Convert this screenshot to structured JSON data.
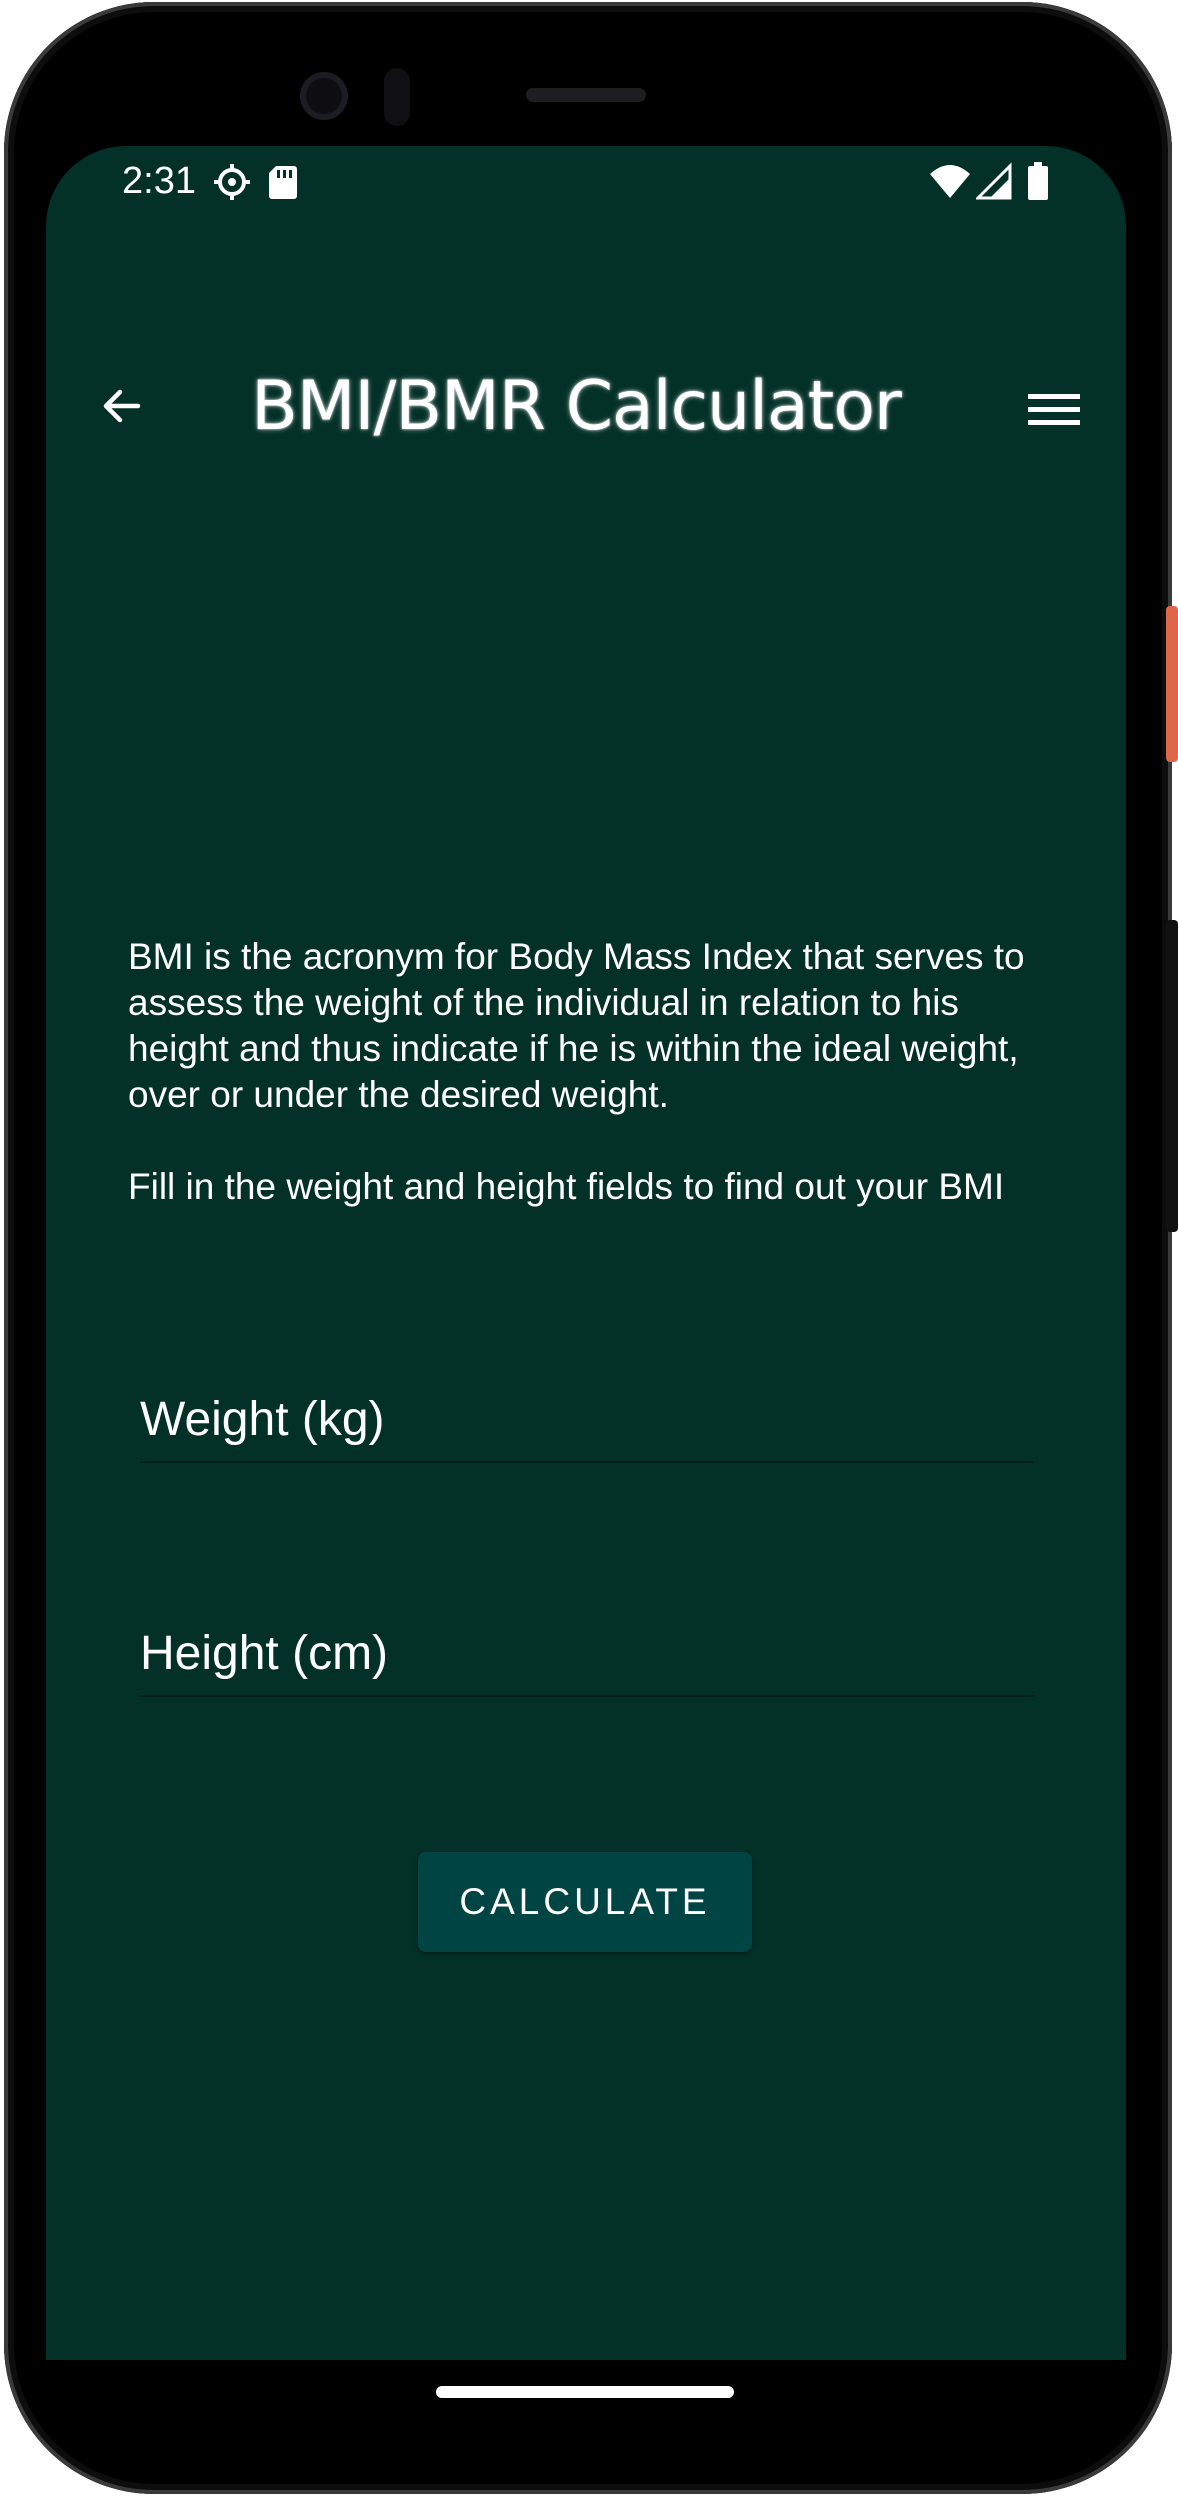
{
  "status_bar": {
    "time": "2:31",
    "icons_left": [
      "settings-gear-icon",
      "sd-card-icon"
    ],
    "icons_right": [
      "wifi-icon",
      "cell-signal-icon",
      "battery-icon"
    ]
  },
  "app_bar": {
    "title": "BMI/BMR Calculator",
    "back_icon": "arrow-left-icon",
    "menu_icon": "hamburger-menu-icon"
  },
  "description": {
    "paragraph_1": "BMI is the acronym for Body Mass Index that serves to assess the weight of the individual in relation to his height and thus indicate if he is within the ideal weight, over or under the desired weight.",
    "paragraph_2": "Fill in the weight and height fields to find out your BMI"
  },
  "form": {
    "weight": {
      "placeholder": "Weight (kg)",
      "value": ""
    },
    "height": {
      "placeholder": "Height (cm)",
      "value": ""
    },
    "calculate_label": "CALCULATE"
  },
  "colors": {
    "background": "#033027",
    "button": "#004444",
    "text": "#ffffff",
    "underline": "#021f19"
  }
}
